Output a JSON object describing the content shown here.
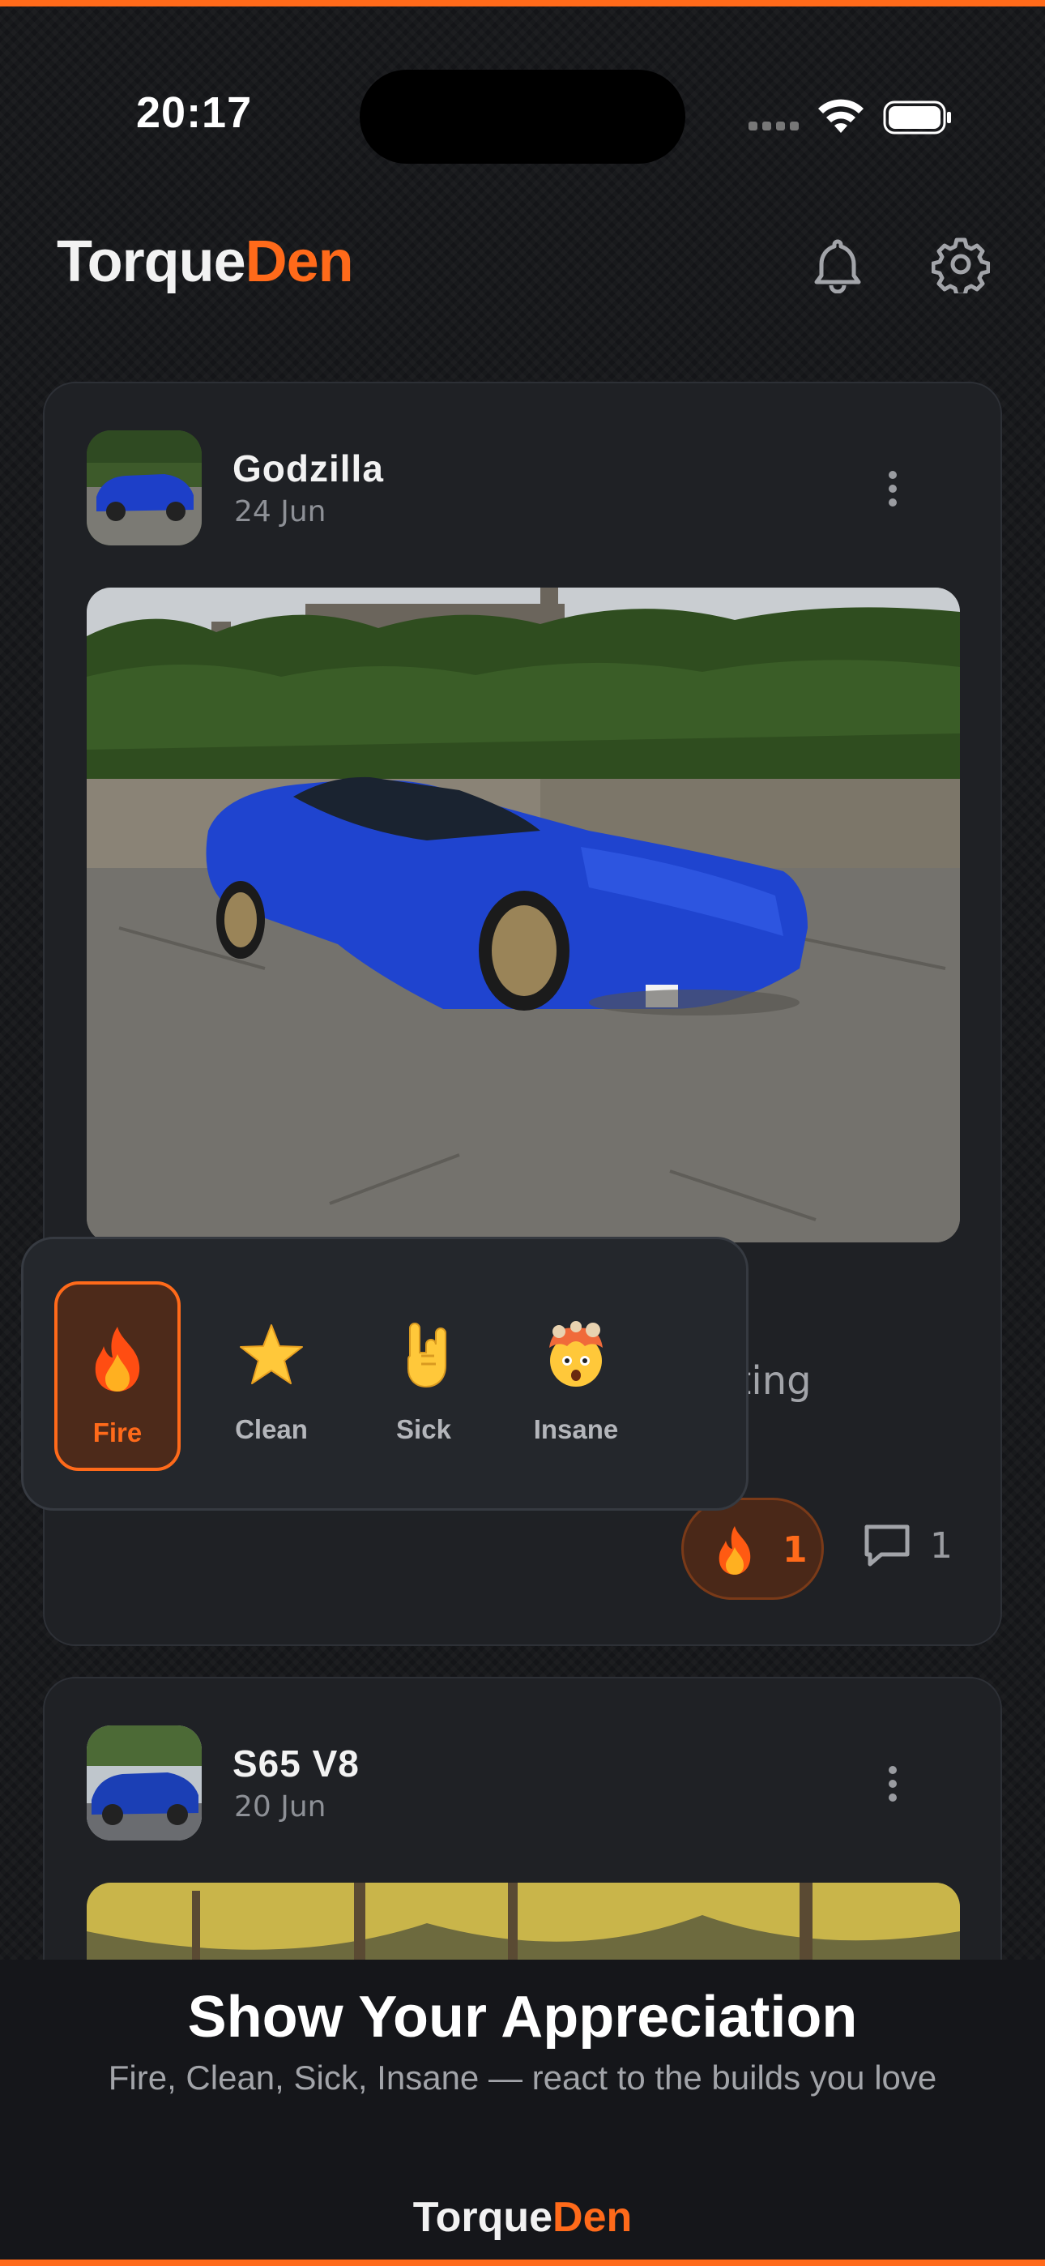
{
  "status_bar": {
    "time": "20:17"
  },
  "header": {
    "brand_part1": "Torque",
    "brand_part2": "Den"
  },
  "posts": [
    {
      "author": "Godzilla",
      "date": "24 Jun",
      "caption_fragment": "eting",
      "reaction_count": "1",
      "comment_count": "1"
    },
    {
      "author": "S65 V8",
      "date": "20 Jun"
    }
  ],
  "reaction_picker": {
    "options": [
      {
        "label": "Fire",
        "icon": "fire-icon",
        "selected": true
      },
      {
        "label": "Clean",
        "icon": "star-icon",
        "selected": false
      },
      {
        "label": "Sick",
        "icon": "rock-hand-icon",
        "selected": false
      },
      {
        "label": "Insane",
        "icon": "mind-blown-icon",
        "selected": false
      }
    ]
  },
  "promo": {
    "title": "Show Your Appreciation",
    "subtitle": "Fire, Clean, Sick, Insane — react to the builds you love",
    "brand_part1": "Torque",
    "brand_part2": "Den"
  },
  "colors": {
    "accent": "#ff6a1a",
    "background": "#141518",
    "card": "#1f2125"
  }
}
